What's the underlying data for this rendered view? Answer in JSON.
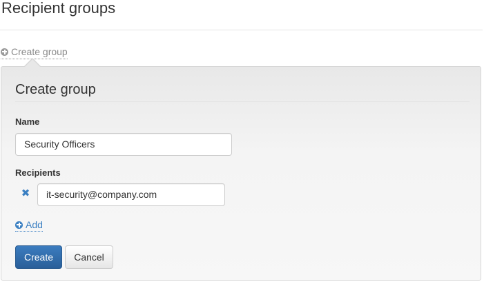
{
  "page": {
    "title": "Recipient groups"
  },
  "toggle": {
    "label": "Create group",
    "icon": "plus-circle-icon"
  },
  "form": {
    "heading": "Create group",
    "name_label": "Name",
    "name_value": "Security Officers",
    "recipients_label": "Recipients",
    "recipients": [
      {
        "value": "it-security@company.com",
        "remove_icon": "remove-x-icon"
      }
    ],
    "add_label": "Add",
    "create_label": "Create",
    "cancel_label": "Cancel"
  },
  "colors": {
    "accent": "#3a7fc2",
    "primary_button": "#2f6aa8",
    "muted_link": "#8a8a8a"
  }
}
